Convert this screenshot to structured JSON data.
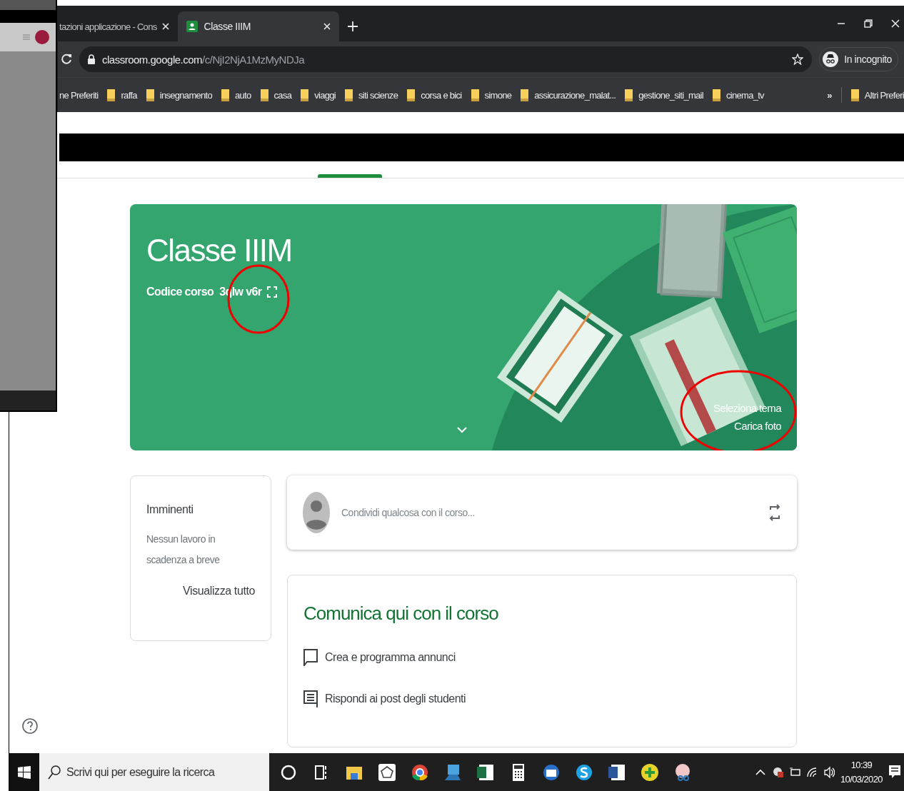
{
  "browser": {
    "tabs": [
      {
        "title": "tazioni applicazione - Cons",
        "selected": false
      },
      {
        "title": "Classe IIIM",
        "selected": true
      }
    ],
    "url_host": "classroom.google.com",
    "url_path": "/c/NjI2NjA1MzMyNDJa",
    "profile": "In incognito",
    "bar_start": "ne Preferiti",
    "bookmarks": [
      "raffa",
      "insegnamento",
      "auto",
      "casa",
      "viaggi",
      "siti scienze",
      "corsa e bici",
      "simone",
      "assicurazione_malat...",
      "gestione_siti_mail",
      "cinema_tv"
    ],
    "more": "»",
    "other_bookmarks": "Altri Preferi"
  },
  "banner": {
    "title": "Classe IIIM",
    "code_label": "Codice corso",
    "code": "3qlw v6r",
    "select_theme": "Seleziona tema",
    "upload_photo": "Carica foto"
  },
  "upcoming": {
    "title": "Imminenti",
    "message": "Nessun lavoro in scadenza a breve",
    "link": "Visualizza tutto"
  },
  "share": {
    "placeholder": "Condividi qualcosa con il corso..."
  },
  "communicate": {
    "title": "Comunica qui con il corso",
    "items": [
      {
        "kind": "announce",
        "label": "Crea e programma annunci"
      },
      {
        "kind": "reply",
        "label": "Rispondi ai post degli studenti"
      }
    ]
  },
  "taskbar": {
    "search_placeholder": "Scrivi qui per eseguire la ricerca",
    "time": "10:39",
    "date": "10/03/2020"
  }
}
